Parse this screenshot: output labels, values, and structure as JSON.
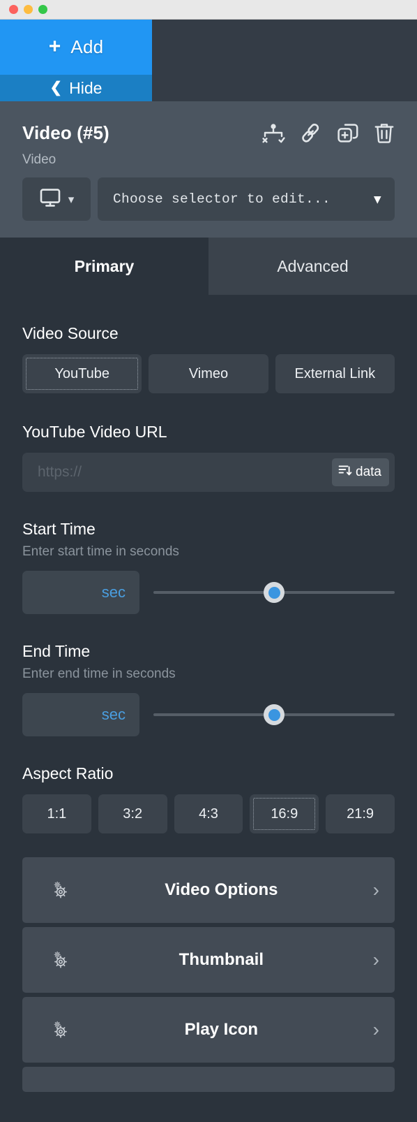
{
  "window": {
    "traffic_lights": [
      "close",
      "minimize",
      "maximize"
    ]
  },
  "topbar": {
    "add_label": "Add",
    "add_icon": "plus-icon",
    "hide_label": "Hide",
    "hide_icon": "chevron-left-icon",
    "add_color": "#2196f3",
    "hide_color": "#1b7fc4"
  },
  "element_header": {
    "title": "Video (#5)",
    "subtitle": "Video",
    "icons": [
      {
        "name": "conditions-icon",
        "title": "Conditions"
      },
      {
        "name": "link-icon",
        "title": "Link"
      },
      {
        "name": "duplicate-icon",
        "title": "Duplicate"
      },
      {
        "name": "trash-icon",
        "title": "Delete"
      }
    ],
    "device_icon": "desktop-icon",
    "device_chevron": "chevron-down-icon",
    "selector_value": "Choose selector to edit...",
    "selector_chevron": "chevron-down-icon",
    "panel_color": "#4b5560"
  },
  "tabs": [
    {
      "label": "Primary",
      "active": true
    },
    {
      "label": "Advanced",
      "active": false
    }
  ],
  "video_source": {
    "label": "Video Source",
    "options": [
      {
        "label": "YouTube",
        "focused": true
      },
      {
        "label": "Vimeo",
        "focused": false
      },
      {
        "label": "External Link",
        "focused": false
      }
    ]
  },
  "video_url": {
    "label": "YouTube Video URL",
    "value": "",
    "placeholder": "https://",
    "data_button": {
      "label": "data",
      "icon": "sort-descending-icon"
    }
  },
  "start_time": {
    "label": "Start Time",
    "hint": "Enter start time in seconds",
    "input_value": "",
    "input_placeholder": "sec",
    "slider_percent": 50
  },
  "end_time": {
    "label": "End Time",
    "hint": "Enter end time in seconds",
    "input_value": "",
    "input_placeholder": "sec",
    "slider_percent": 50
  },
  "aspect_ratio": {
    "label": "Aspect Ratio",
    "options": [
      {
        "label": "1:1",
        "focused": false
      },
      {
        "label": "3:2",
        "focused": false
      },
      {
        "label": "4:3",
        "focused": false
      },
      {
        "label": "16:9",
        "focused": true
      },
      {
        "label": "21:9",
        "focused": false
      }
    ]
  },
  "accordions": [
    {
      "label": "Video Options",
      "icon": "gears-icon",
      "chevron": "chevron-right-icon"
    },
    {
      "label": "Thumbnail",
      "icon": "gears-icon",
      "chevron": "chevron-right-icon"
    },
    {
      "label": "Play Icon",
      "icon": "gears-icon",
      "chevron": "chevron-right-icon"
    }
  ],
  "colors": {
    "accent": "#2196f3",
    "panel_dark": "#2b333c",
    "panel_mid": "#3b434c",
    "panel_light": "#4b5560",
    "slider_blue": "#3a95e0",
    "input_blue": "#4a9ee0"
  }
}
